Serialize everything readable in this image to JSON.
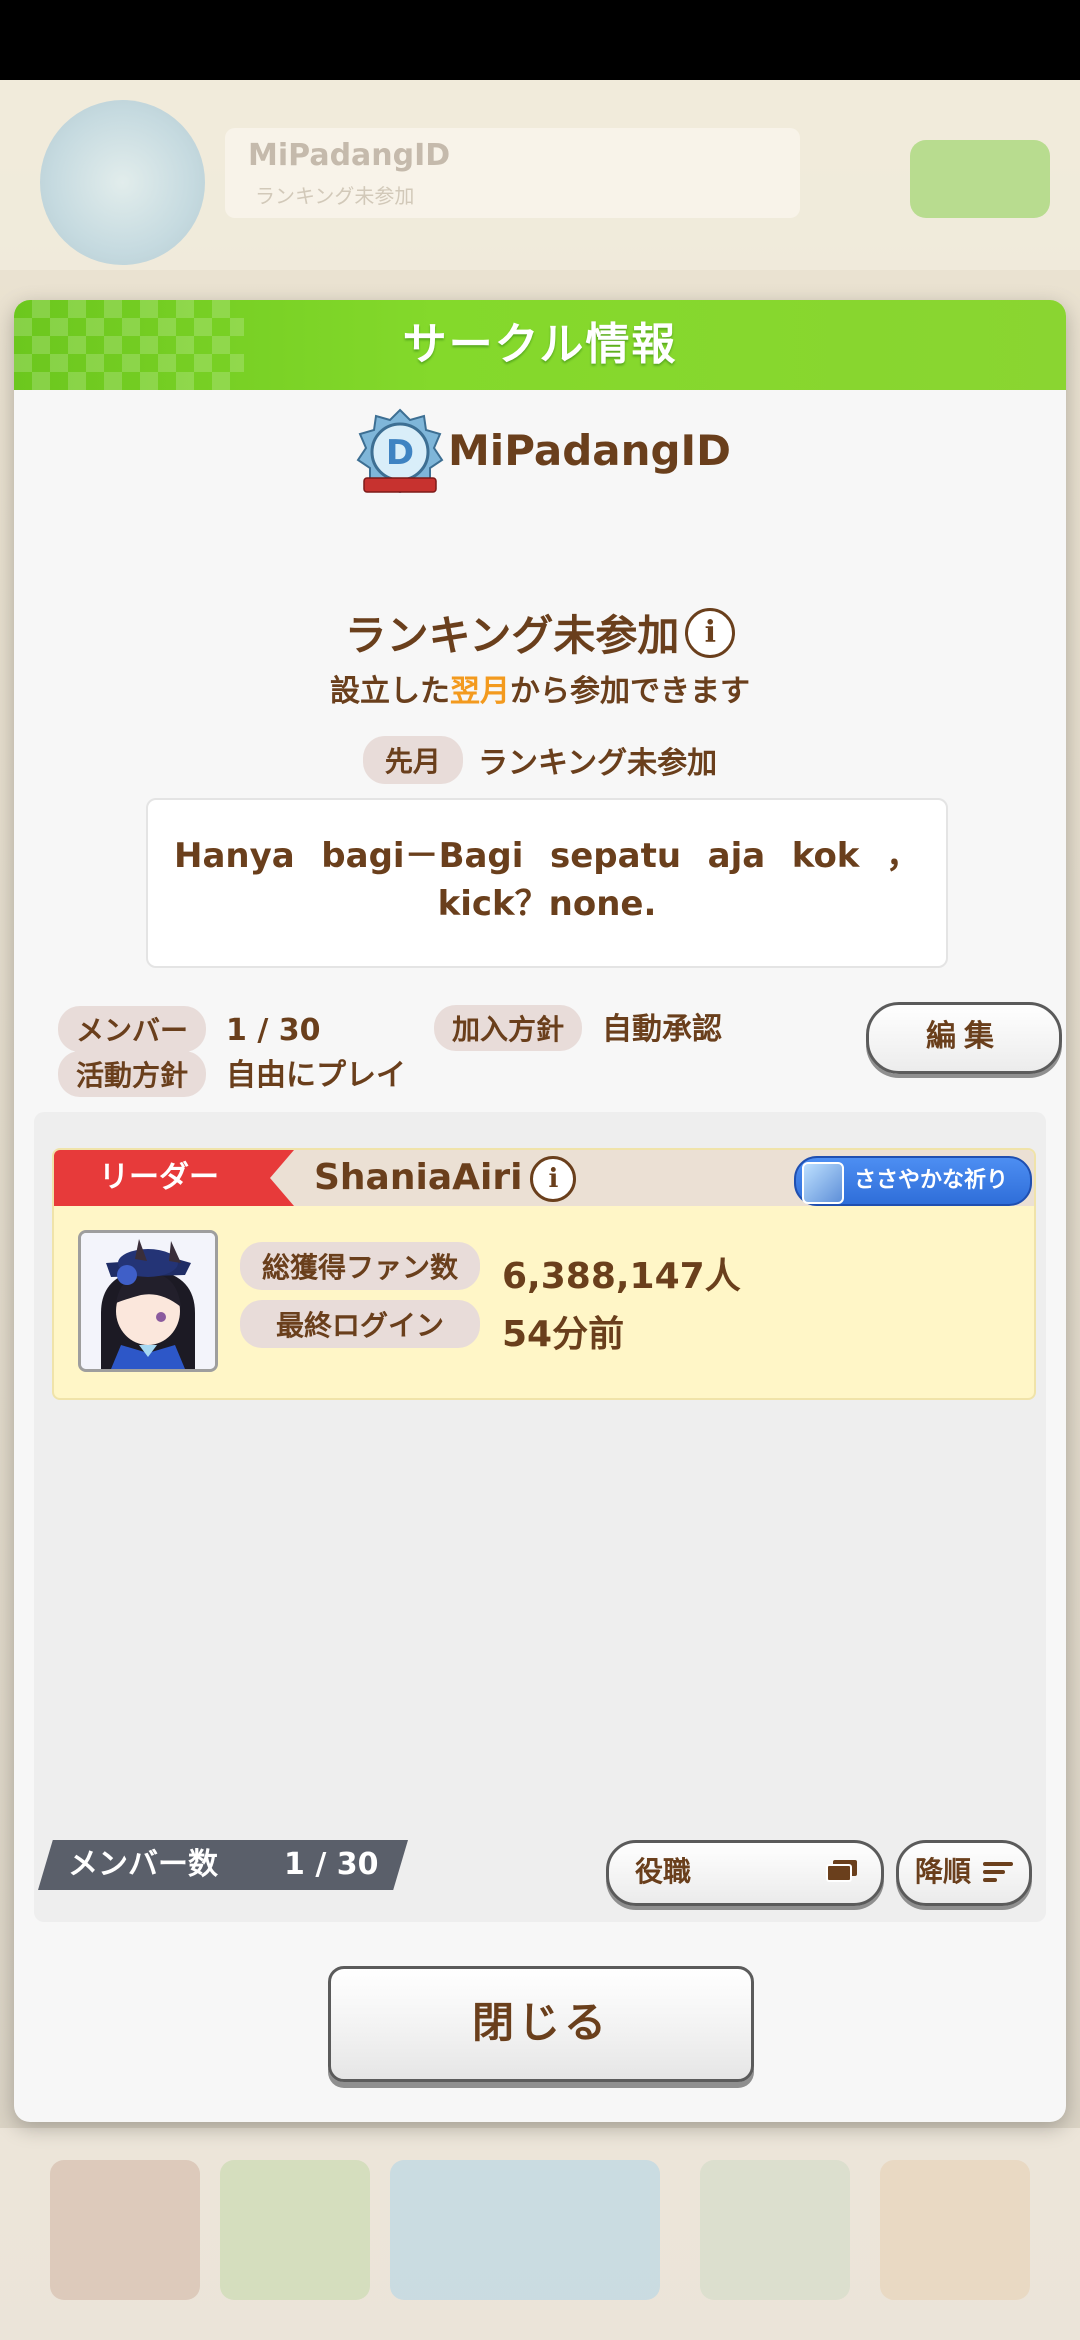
{
  "background": {
    "circle_name": "MiPadangID",
    "ranking_status": "ランキング未参加"
  },
  "dialog": {
    "title": "サークル情報",
    "circle_name": "MiPadangID",
    "ranking": {
      "status": "ランキング未参加",
      "note_prefix": "設立した",
      "note_highlight": "翌月",
      "note_suffix": "から参加できます",
      "last_month_label": "先月",
      "last_month_value": "ランキング未参加"
    },
    "description": "Hanya bagi－Bagi sepatu aja kok ，kick？none.",
    "meta": {
      "member_label": "メンバー",
      "member_value": "1 / 30",
      "join_policy_label": "加入方針",
      "join_policy_value": "自動承認",
      "activity_label": "活動方針",
      "activity_value": "自由にプレイ"
    },
    "edit_button": "編集",
    "leader": {
      "role": "リーダー",
      "name": "ShaniaAiri",
      "title_badge": "ささやかな祈り",
      "fans_label": "総獲得ファン数",
      "fans_value": "6,388,147人",
      "last_login_label": "最終ログイン",
      "last_login_value": "54分前"
    },
    "footer": {
      "member_count_label": "メンバー数",
      "member_count_value": "1 / 30",
      "role_sort_button": "役職",
      "order_button": "降順"
    },
    "close_button": "閉じる"
  },
  "colors": {
    "header_green": "#7ccf25",
    "text_brown": "#6a3f1c",
    "highlight_orange": "#f39a1e",
    "leader_red": "#e73a3a",
    "badge_blue": "#3a7ae3"
  }
}
